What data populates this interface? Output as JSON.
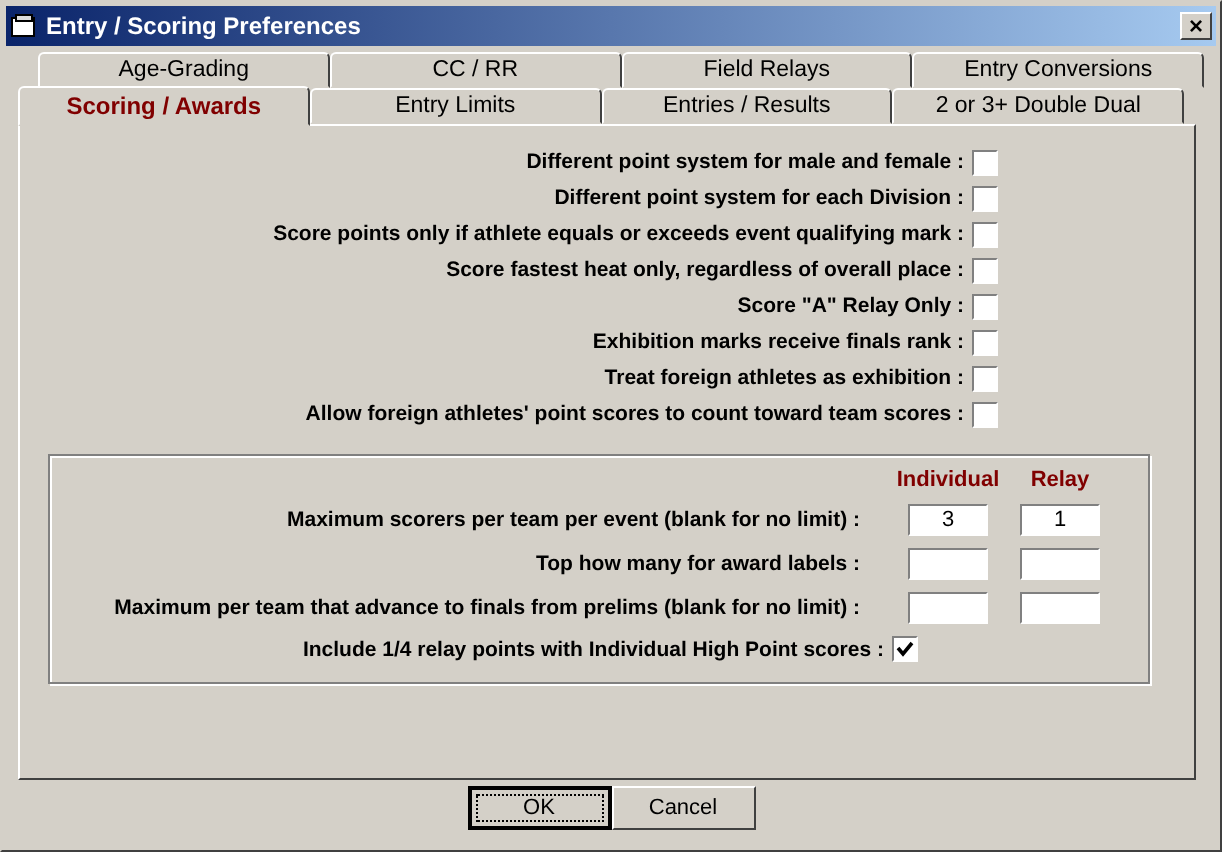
{
  "window": {
    "title": "Entry / Scoring Preferences",
    "close": "×"
  },
  "tab_rows": [
    [
      {
        "label": "Age-Grading",
        "selected": false
      },
      {
        "label": "CC / RR",
        "selected": false
      },
      {
        "label": "Field Relays",
        "selected": false
      },
      {
        "label": "Entry Conversions",
        "selected": false
      }
    ],
    [
      {
        "label": "Scoring / Awards",
        "selected": true
      },
      {
        "label": "Entry Limits",
        "selected": false
      },
      {
        "label": "Entries / Results",
        "selected": false
      },
      {
        "label": "2 or 3+ Double Dual",
        "selected": false
      }
    ]
  ],
  "options": [
    {
      "label": "Different point system for male and female :",
      "checked": false
    },
    {
      "label": "Different point system for each Division :",
      "checked": false
    },
    {
      "label": "Score points only if athlete equals or exceeds event qualifying mark :",
      "checked": false
    },
    {
      "label": "Score fastest heat only, regardless of overall place :",
      "checked": false
    },
    {
      "label": "Score \"A\" Relay Only :",
      "checked": false
    },
    {
      "label": "Exhibition marks receive finals rank :",
      "checked": false
    },
    {
      "label": "Treat foreign athletes as exhibition :",
      "checked": false
    },
    {
      "label": "Allow foreign athletes' point scores to count toward team scores :",
      "checked": false
    }
  ],
  "limits": {
    "columns": [
      "Individual",
      "Relay"
    ],
    "rows": [
      {
        "kind": "inputs",
        "label": "Maximum scorers per team per event (blank for no limit) :",
        "individual": "3",
        "relay": "1"
      },
      {
        "kind": "inputs",
        "label": "Top how many for award labels :"
      },
      {
        "kind": "inputs",
        "label": "Maximum per team that advance to finals from prelims (blank for no limit) :"
      },
      {
        "kind": "checkbox",
        "label": "Include 1/4 relay points with Individual High Point scores :",
        "checked": true
      }
    ]
  },
  "buttons": [
    {
      "label": "OK",
      "focused": true
    },
    {
      "label": "Cancel",
      "focused": false
    }
  ]
}
